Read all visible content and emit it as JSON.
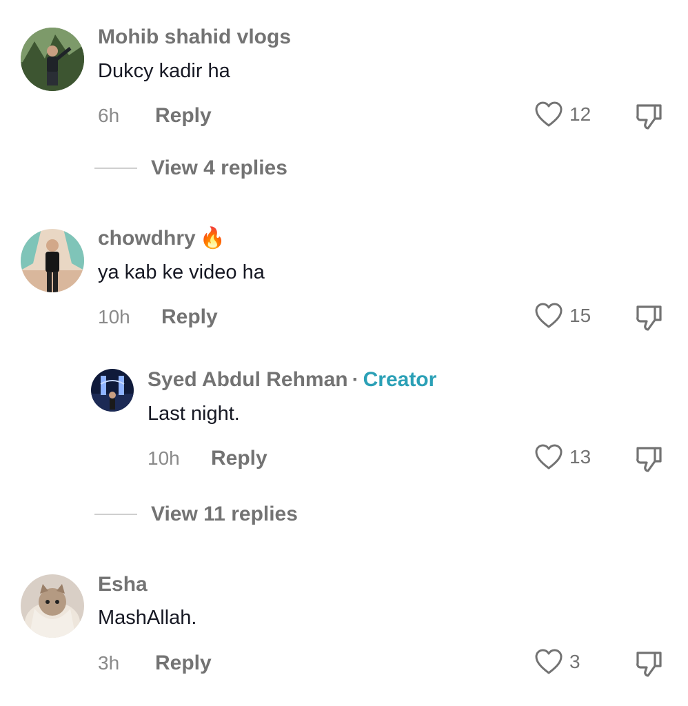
{
  "comments": [
    {
      "username": "Mohib shahid vlogs",
      "text": "Dukcy kadir ha",
      "time": "6h",
      "reply_label": "Reply",
      "likes": "12",
      "view_replies": "View 4 replies"
    },
    {
      "username": "chowdhry",
      "emoji": "🔥",
      "text": "ya kab ke video ha",
      "time": "10h",
      "reply_label": "Reply",
      "likes": "15",
      "reply": {
        "username": "Syed Abdul Rehman",
        "separator": "·",
        "badge": "Creator",
        "text": "Last night.",
        "time": "10h",
        "reply_label": "Reply",
        "likes": "13"
      },
      "view_replies": "View 11 replies"
    },
    {
      "username": "Esha",
      "text": "MashAllah.",
      "time": "3h",
      "reply_label": "Reply",
      "likes": "3"
    }
  ],
  "icons": {
    "like": "heart-outline-icon",
    "dislike": "thumbs-down-icon"
  },
  "colors": {
    "creator_badge": "#2ba0b6",
    "secondary_text": "#737373",
    "primary_text": "#161823"
  }
}
